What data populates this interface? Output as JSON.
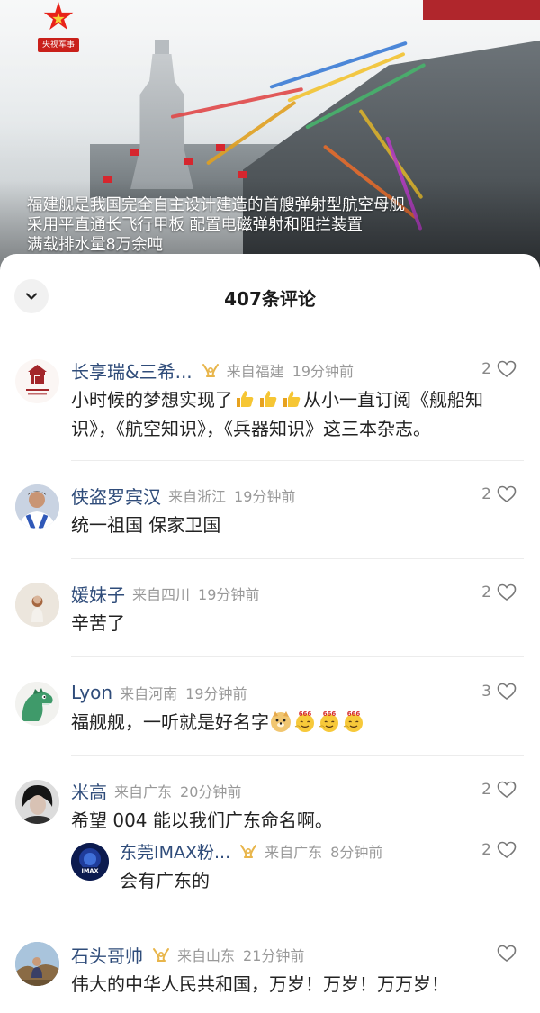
{
  "video": {
    "logo_text": "央视军事",
    "caption_lines": [
      "福建舰是我国完全自主设计建造的首艘弹射型航空母舰",
      "采用平直通长飞行甲板 配置电磁弹射和阻拦装置",
      "满载排水量8万余吨"
    ]
  },
  "sheet": {
    "title": "407条评论"
  },
  "comments": [
    {
      "username": "长享瑞&三希...",
      "location": "来自福建",
      "time": "19分钟前",
      "likes": "2",
      "text_before": "小时候的梦想实现了",
      "text_after": "从小一直订阅《舰船知识》，《航空知识》，《兵器知识》这三本杂志。",
      "emoji": "thumbs-up x3"
    },
    {
      "username": "侠盗罗宾汉",
      "location": "来自浙江",
      "time": "19分钟前",
      "likes": "2",
      "text": "统一祖国 保家卫国"
    },
    {
      "username": "媛妹子",
      "location": "来自四川",
      "time": "19分钟前",
      "likes": "2",
      "text": "辛苦了"
    },
    {
      "username": "Lyon",
      "location": "来自河南",
      "time": "19分钟前",
      "likes": "3",
      "text": "福舰舰，一听就是好名字",
      "emoji": "doge, 666 x3"
    },
    {
      "username": "米高",
      "location": "来自广东",
      "time": "20分钟前",
      "likes": "2",
      "text": "希望 004 能以我们广东命名啊。",
      "reply": {
        "username": "东莞IMAX粉...",
        "location": "来自广东",
        "time": "8分钟前",
        "likes": "2",
        "text": "会有广东的"
      }
    },
    {
      "username": "石头哥帅",
      "location": "来自山东",
      "time": "21分钟前",
      "likes": "",
      "text": "伟大的中华人民共和国，万岁！万岁！万万岁！"
    }
  ],
  "colors": {
    "username": "#2f4c7a",
    "meta": "#999999",
    "text": "#222222",
    "vip_badge": "#e8b54a"
  }
}
